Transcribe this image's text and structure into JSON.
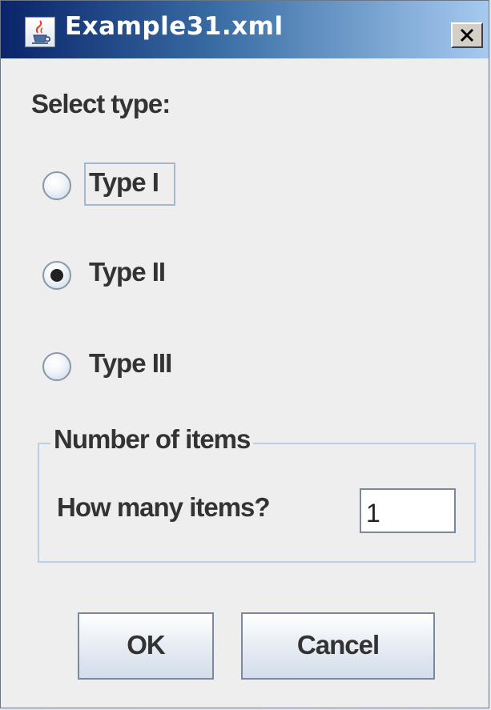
{
  "window": {
    "title": "Example31.xml",
    "app_icon": "java-cup-icon",
    "close_icon": "close-icon"
  },
  "form": {
    "select_label": "Select type:",
    "radio_options": [
      {
        "label": "Type I",
        "selected": false
      },
      {
        "label": "Type II",
        "selected": true
      },
      {
        "label": "Type III",
        "selected": false
      }
    ],
    "group": {
      "legend": "Number of items",
      "field_label": "How many items?",
      "field_value": "1"
    }
  },
  "buttons": {
    "ok_label": "OK",
    "cancel_label": "Cancel"
  },
  "colors": {
    "titlebar_start": "#0a246a",
    "titlebar_end": "#a6caf0",
    "window_bg": "#eeeeee",
    "group_border": "#b8cfe5"
  }
}
